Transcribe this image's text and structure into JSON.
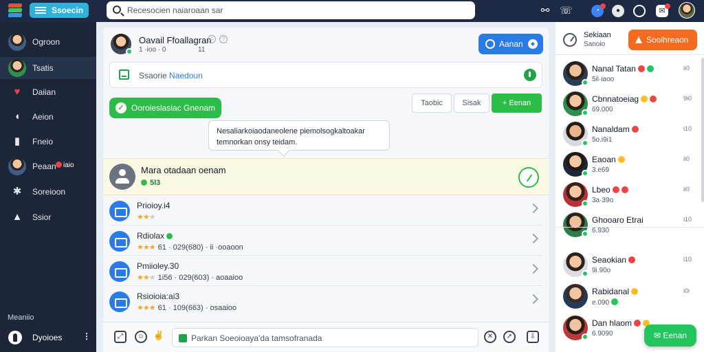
{
  "topbar": {
    "brand_label": "Ssoecin",
    "search_value": "Recesocien naiaroaan sar",
    "colors": {
      "bar": "#1e2a44",
      "brand": "#2fb2d9"
    },
    "icons": [
      "link-icon",
      "phone-icon",
      "notification-icon",
      "status-icon",
      "ring-icon",
      "messages-icon"
    ]
  },
  "sidebar": {
    "items": [
      {
        "label": "Ogroon",
        "icon": "avatar"
      },
      {
        "label": "Tsatis",
        "icon": "avatar"
      },
      {
        "label": "Daiian",
        "icon": "heart-icon"
      },
      {
        "label": "Aeion",
        "icon": "chat-icon"
      },
      {
        "label": "Fneio",
        "icon": "door-icon"
      },
      {
        "label": "Peaan",
        "icon": "avatar",
        "badge": "iaio"
      },
      {
        "label": "Soreioon",
        "icon": "gear-icon"
      },
      {
        "label": "Ssior",
        "icon": "user-icon"
      }
    ],
    "section_label": "Meaniio",
    "bottom_label": "Dyoioes",
    "bottom_menu": "⋮"
  },
  "main": {
    "header": {
      "name": "Oavail Ffoallagran",
      "sub1": "1 ·ioo · 0",
      "sub2": "11",
      "action_label": "Aanan"
    },
    "search_bar": {
      "prefix": "Ssaorie",
      "highlight": "Naedoun"
    },
    "success_pill": "Ooroieslasiac Gnenam",
    "segments": [
      "Taobic",
      "Sisak",
      "Eenan"
    ],
    "tooltip": "Nesaliarkoiaodaneolene piemolsogkaltoakar temnorkan onsy teidam.",
    "highlight": {
      "title": "Mara otadaan oenam",
      "meta": "5l3"
    },
    "rows": [
      {
        "title": "Prioioy.i4",
        "stars": "★★",
        "meta": ""
      },
      {
        "title": "Rdiolax",
        "stars": "★★",
        "meta": "61 · 029(680) · ii ·ooaoon"
      },
      {
        "title": "Pmiioley.30",
        "stars": "★★",
        "meta": "1i56 · 029(603) · aoaaioo"
      },
      {
        "title": "Rsioioia:ai3",
        "stars": "★★",
        "meta": "61 · 109(663) · osaaioo"
      }
    ],
    "composer_placeholder": "Parkan Soeoioaya'da tamsofranada"
  },
  "right_panel": {
    "head_title": "Sekiaan",
    "head_sub": "Sanoio",
    "head_button": "Sooihreaon",
    "contacts": [
      {
        "name": "Nanal Tatan",
        "sub": "5il·iaoo",
        "time": "ii0",
        "emoji": [
          "red",
          "green"
        ]
      },
      {
        "name": "Cbnnatoeiag",
        "sub": "69.000",
        "time": "9i0",
        "emoji": [
          "yellow",
          "red"
        ]
      },
      {
        "name": "Nanaldam",
        "sub": "5o.i9i1",
        "time": "i10",
        "emoji": [
          "red"
        ]
      },
      {
        "name": "Eaoan",
        "sub": "3.e69",
        "time": "ii0",
        "emoji": [
          "yellow"
        ]
      },
      {
        "name": "Lbeo",
        "sub": "3a·39o",
        "time": "ii0",
        "emoji": [
          "red",
          "red"
        ]
      },
      {
        "name": "Ghooaro Etrai",
        "sub": "6.930",
        "time": "i10",
        "emoji": []
      },
      {
        "name": "Seaokian",
        "sub": "9i.90o",
        "time": "i10",
        "emoji": [
          "red"
        ]
      },
      {
        "name": "Rabidanal",
        "sub": "e.090",
        "time": "i0i",
        "emoji": [
          "yellow"
        ]
      },
      {
        "name": "Dan hlaom",
        "sub": "6.9090",
        "time": "",
        "emoji": [
          "red",
          "yellow"
        ]
      }
    ],
    "float_button": "Eenan"
  }
}
